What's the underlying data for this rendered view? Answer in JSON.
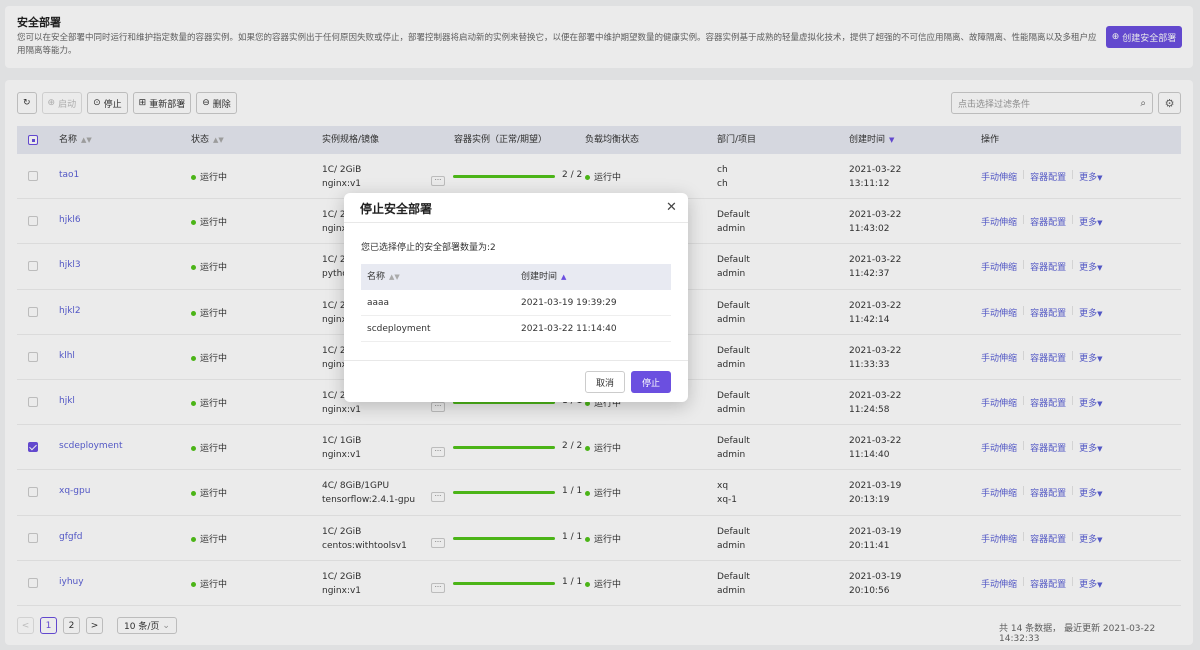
{
  "header": {
    "title": "安全部署",
    "description": "您可以在安全部署中同时运行和维护指定数量的容器实例。如果您的容器实例出于任何原因失败或停止，部署控制器将启动新的实例来替换它，以便在部署中维护期望数量的健康实例。容器实例基于成熟的轻量虚拟化技术，提供了超强的不可信应用隔离、故障隔离、性能隔离以及多租户应用隔离等能力。",
    "create_button": "创建安全部署"
  },
  "toolbar": {
    "refresh_icon": "refresh-icon",
    "start": "启动",
    "stop": "停止",
    "redeploy": "重新部署",
    "delete": "删除",
    "filter_placeholder": "点击选择过滤条件"
  },
  "table": {
    "columns": [
      "名称",
      "状态",
      "实例规格/镜像",
      "容器实例（正常/期望）",
      "负载均衡状态",
      "部门/项目",
      "创建时间",
      "操作"
    ],
    "ops": [
      "手动伸缩",
      "容器配置",
      "更多"
    ],
    "rows": [
      {
        "name": "tao1",
        "status": "运行中",
        "spec": "1C/ 2GiB",
        "image": "nginx:v1",
        "instances": "2 / 2",
        "ratio": 1.0,
        "lb": "运行中",
        "dept": "ch",
        "project": "ch",
        "date": "2021-03-22",
        "time": "13:11:12",
        "checked": false
      },
      {
        "name": "hjkl6",
        "status": "运行中",
        "spec": "1C/ 2G",
        "image": "nginx:v",
        "instances": "",
        "ratio": 1.0,
        "lb": "",
        "dept": "Default",
        "project": "admin",
        "date": "2021-03-22",
        "time": "11:43:02",
        "checked": false
      },
      {
        "name": "hjkl3",
        "status": "运行中",
        "spec": "1C/ 2G",
        "image": "python",
        "instances": "",
        "ratio": 1.0,
        "lb": "",
        "dept": "Default",
        "project": "admin",
        "date": "2021-03-22",
        "time": "11:42:37",
        "checked": false
      },
      {
        "name": "hjkl2",
        "status": "运行中",
        "spec": "1C/ 2G",
        "image": "nginx:v",
        "instances": "",
        "ratio": 1.0,
        "lb": "",
        "dept": "Default",
        "project": "admin",
        "date": "2021-03-22",
        "time": "11:42:14",
        "checked": false
      },
      {
        "name": "klhl",
        "status": "运行中",
        "spec": "1C/ 2G",
        "image": "nginx:v",
        "instances": "",
        "ratio": 1.0,
        "lb": "",
        "dept": "Default",
        "project": "admin",
        "date": "2021-03-22",
        "time": "11:33:33",
        "checked": false
      },
      {
        "name": "hjkl",
        "status": "运行中",
        "spec": "1C/ 2G",
        "image": "nginx:v1",
        "instances": "1 / 1",
        "ratio": 1.0,
        "lb": "运行中",
        "dept": "Default",
        "project": "admin",
        "date": "2021-03-22",
        "time": "11:24:58",
        "checked": false
      },
      {
        "name": "scdeployment",
        "status": "运行中",
        "spec": "1C/ 1GiB",
        "image": "nginx:v1",
        "instances": "2 / 2",
        "ratio": 1.0,
        "lb": "运行中",
        "dept": "Default",
        "project": "admin",
        "date": "2021-03-22",
        "time": "11:14:40",
        "checked": true
      },
      {
        "name": "xq-gpu",
        "status": "运行中",
        "spec": "4C/ 8GiB/1GPU",
        "image": "tensorflow:2.4.1-gpu",
        "instances": "1 / 1",
        "ratio": 1.0,
        "lb": "运行中",
        "dept": "xq",
        "project": "xq-1",
        "date": "2021-03-19",
        "time": "20:13:19",
        "checked": false
      },
      {
        "name": "gfgfd",
        "status": "运行中",
        "spec": "1C/ 2GiB",
        "image": "centos:withtoolsv1",
        "instances": "1 / 1",
        "ratio": 1.0,
        "lb": "运行中",
        "dept": "Default",
        "project": "admin",
        "date": "2021-03-19",
        "time": "20:11:41",
        "checked": false
      },
      {
        "name": "iyhuy",
        "status": "运行中",
        "spec": "1C/ 2GiB",
        "image": "nginx:v1",
        "instances": "1 / 1",
        "ratio": 1.0,
        "lb": "运行中",
        "dept": "Default",
        "project": "admin",
        "date": "2021-03-19",
        "time": "20:10:56",
        "checked": false
      }
    ]
  },
  "pagination": {
    "prev": "<",
    "pages": [
      "1",
      "2"
    ],
    "next": ">",
    "page_size": "10 条/页",
    "total": "共 14 条数据，",
    "last_update": "最近更新 2021-03-22 14:32:33"
  },
  "modal": {
    "title": "停止安全部署",
    "message": "您已选择停止的安全部署数量为:2",
    "columns": [
      "名称",
      "创建时间"
    ],
    "rows": [
      {
        "name": "aaaa",
        "time": "2021-03-19 19:39:29"
      },
      {
        "name": "scdeployment",
        "time": "2021-03-22 11:14:40"
      }
    ],
    "cancel": "取消",
    "confirm": "停止"
  },
  "colors": {
    "accent": "#6b4fe0",
    "link": "#5a5fd6",
    "running": "#52c41a"
  }
}
